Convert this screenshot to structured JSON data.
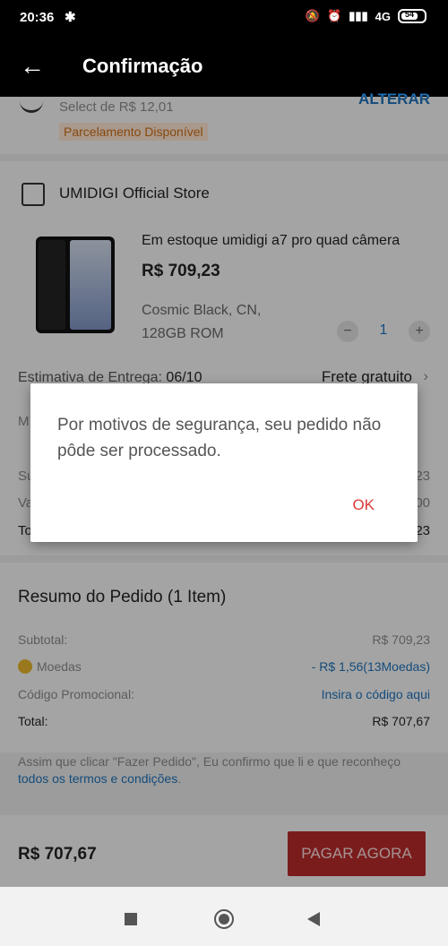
{
  "status": {
    "time": "20:36",
    "network": "4G",
    "battery": "54"
  },
  "appbar": {
    "title": "Confirmação"
  },
  "payment": {
    "select_text": "Select de R$ 12,01",
    "change_label": "ALTERAR",
    "badge": "Parcelamento Disponível"
  },
  "store": {
    "name": "UMIDIGI Official Store",
    "product": {
      "title": "Em estoque umidigi a7 pro quad câmera",
      "price": "R$ 709,23",
      "variant_line1": "Cosmic Black, CN,",
      "variant_line2": "128GB ROM",
      "quantity": "1"
    },
    "delivery_label": "Estimativa de Entrega:",
    "delivery_date": "06/10",
    "shipping": "Frete gratuito",
    "hidden_rows": {
      "m": "M",
      "su": "Su",
      "va": "Va",
      "to": "To",
      "r1": "23",
      "r2": "00",
      "r3": "23"
    }
  },
  "summary": {
    "heading": "Resumo do Pedido (1 Item)",
    "subtotal_label": "Subtotal:",
    "subtotal_value": "R$ 709,23",
    "coins_label": "Moedas",
    "coins_value": "- R$ 1,56(13Moedas)",
    "promo_label": "Código Promocional:",
    "promo_value": "Insira o código aqui",
    "total_label": "Total:",
    "total_value": "R$ 707,67"
  },
  "terms": {
    "text": "Assim que clicar \"Fazer Pedido\", Eu confirmo que li e que reconheço ",
    "link": "todos os termos e condições",
    "end": "."
  },
  "bottom": {
    "total": "R$ 707,67",
    "pay_label": "PAGAR AGORA"
  },
  "dialog": {
    "message": "Por motivos de segurança, seu pedido não pôde ser processado.",
    "ok_label": "OK"
  }
}
